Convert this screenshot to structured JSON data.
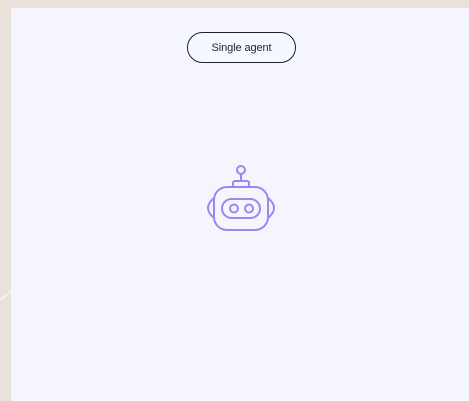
{
  "mode_pill": {
    "label": "Single agent"
  },
  "icons": {
    "robot": "robot-icon"
  },
  "colors": {
    "page_background": "#e8e2da",
    "card_background": "#f5f6fd",
    "pill_border": "#1d2233",
    "robot_stroke": "#9b87f0"
  }
}
